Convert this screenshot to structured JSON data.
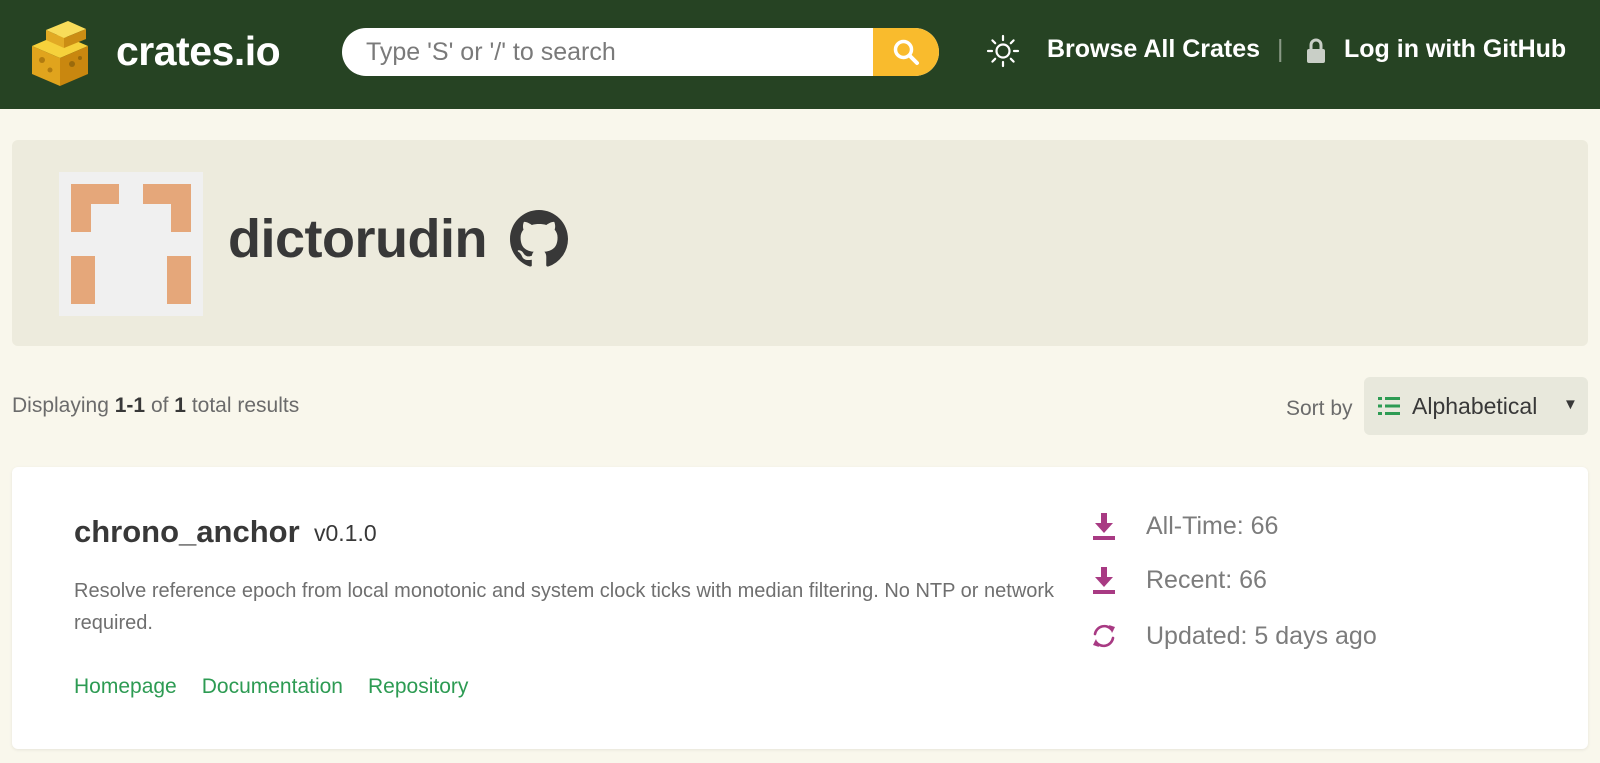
{
  "header": {
    "brand": "crates.io",
    "search_placeholder": "Type 'S' or '/' to search",
    "browse_label": "Browse All Crates",
    "divider": "|",
    "login_label": "Log in with GitHub"
  },
  "profile": {
    "username": "dictorudin"
  },
  "results": {
    "prefix": "Displaying",
    "range": "1-1",
    "of": "of",
    "total": "1",
    "suffix": "total results"
  },
  "sort": {
    "label": "Sort by",
    "value": "Alphabetical"
  },
  "crate": {
    "name": "chrono_anchor",
    "version": "v0.1.0",
    "description": "Resolve reference epoch from local monotonic and system clock ticks with median filtering. No NTP or network required.",
    "links": {
      "homepage": "Homepage",
      "documentation": "Documentation",
      "repository": "Repository"
    },
    "stats": {
      "all_time": "All-Time: 66",
      "recent": "Recent: 66",
      "updated": "Updated: 5 days ago"
    }
  },
  "colors": {
    "header_bg": "#264323",
    "page_bg": "#f9f7ec",
    "accent_yellow": "#f9bb2d",
    "link_green": "#2d9b53",
    "stat_icon_purple": "#a83a83",
    "avatar_orange": "#e5a77a"
  },
  "icons": {
    "logo": "cargo-crates-icon",
    "search": "search-icon",
    "theme": "sun-icon",
    "lock": "lock-icon",
    "github": "github-icon",
    "sort": "list-icon",
    "download": "download-icon",
    "updated": "refresh-icon"
  }
}
